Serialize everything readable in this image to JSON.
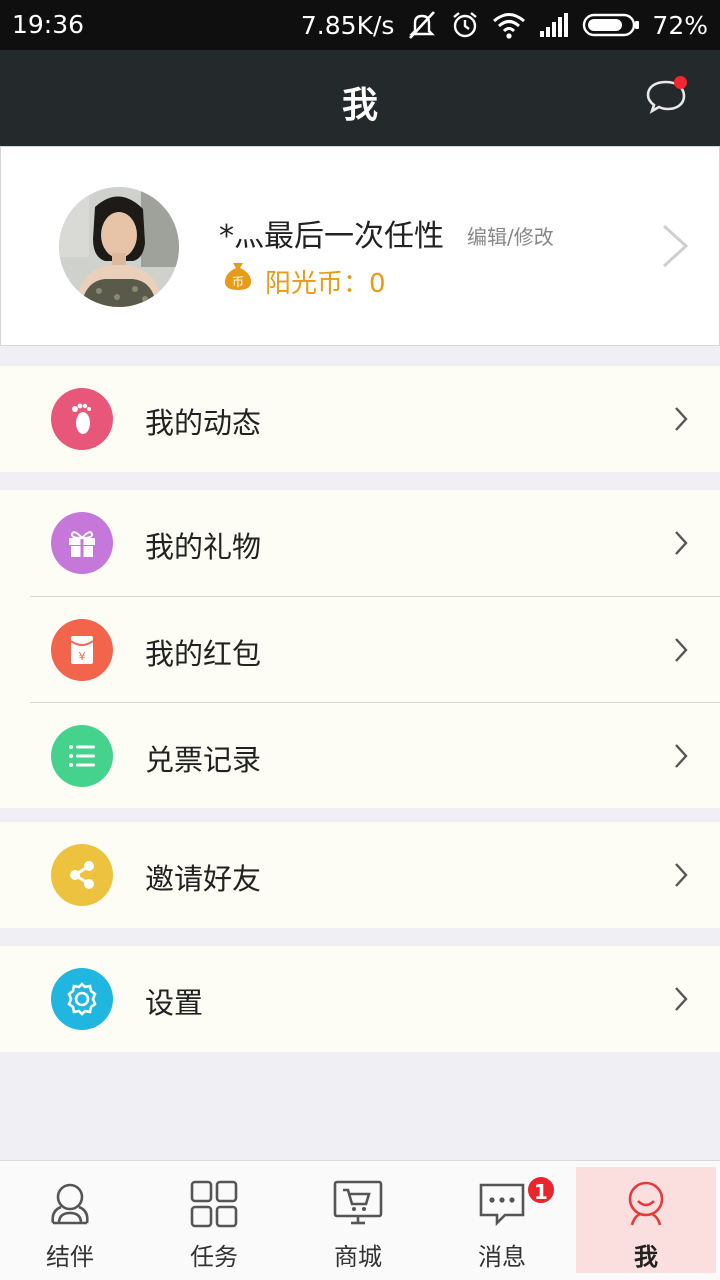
{
  "status_bar": {
    "time": "19:36",
    "speed": "7.85K/s",
    "battery": "72%",
    "icons": [
      "mute-icon",
      "alarm-icon",
      "wifi-icon",
      "signal-icon",
      "battery-icon"
    ]
  },
  "header": {
    "title": "我",
    "message_icon": "chat-bubble-icon"
  },
  "profile": {
    "nickname": "*灬最后一次任性",
    "edit_label": "编辑/修改",
    "coin_label": "阳光币：0",
    "coin_icon": "coin-bag-icon"
  },
  "menu": [
    {
      "label": "我的动态",
      "icon": "footprint-icon",
      "color": "#e8577a"
    },
    {
      "label": "我的礼物",
      "icon": "gift-icon",
      "color": "#c677da"
    },
    {
      "label": "我的红包",
      "icon": "red-envelope-icon",
      "color": "#f2644b"
    },
    {
      "label": "兑票记录",
      "icon": "list-icon",
      "color": "#45d28d"
    },
    {
      "label": "邀请好友",
      "icon": "share-icon",
      "color": "#edc23e"
    },
    {
      "label": "设置",
      "icon": "settings-icon",
      "color": "#21b6e0"
    }
  ],
  "tabs": [
    {
      "label": "结伴",
      "icon": "partner-icon"
    },
    {
      "label": "任务",
      "icon": "grid-icon"
    },
    {
      "label": "商城",
      "icon": "cart-icon"
    },
    {
      "label": "消息",
      "icon": "message-icon",
      "badge": "1"
    },
    {
      "label": "我",
      "icon": "profile-icon",
      "active": true
    }
  ],
  "colors": {
    "header_bg": "#24292c",
    "accent": "#e23c3c",
    "coin": "#e79b18",
    "page_bg": "#efeff4"
  }
}
